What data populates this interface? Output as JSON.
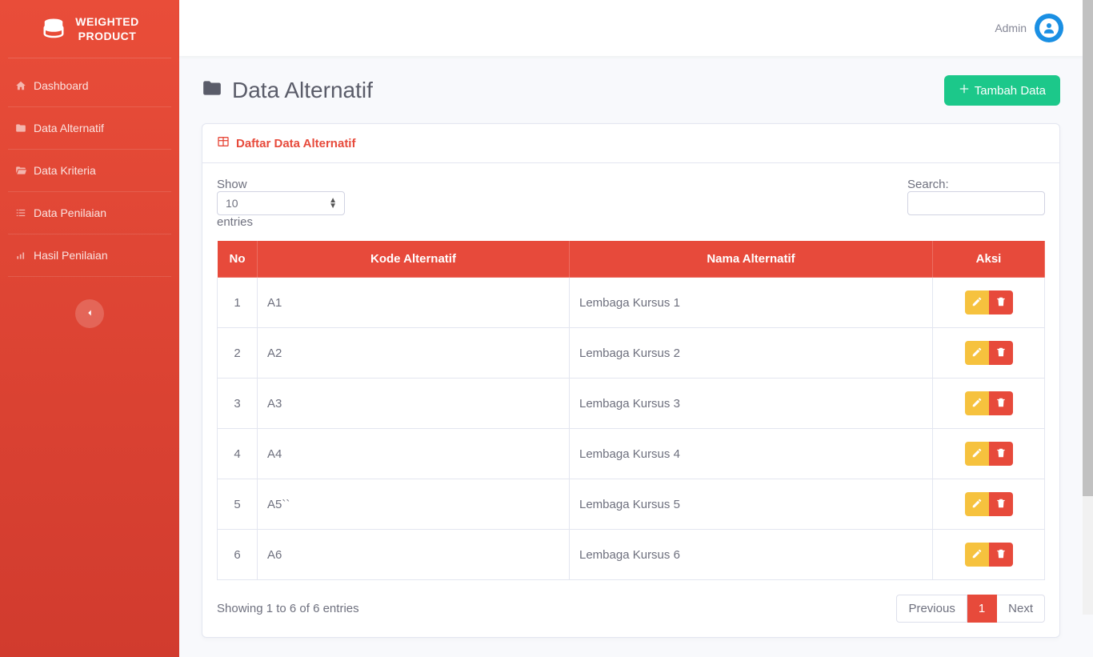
{
  "brand": {
    "line1": "WEIGHTED",
    "line2": "PRODUCT"
  },
  "sidebar": {
    "items": [
      {
        "label": "Dashboard",
        "icon": "dashboard-icon"
      },
      {
        "label": "Data Alternatif",
        "icon": "folder-icon"
      },
      {
        "label": "Data Kriteria",
        "icon": "folder-open-icon"
      },
      {
        "label": "Data Penilaian",
        "icon": "list-icon"
      },
      {
        "label": "Hasil Penilaian",
        "icon": "chart-icon"
      }
    ]
  },
  "topbar": {
    "username": "Admin"
  },
  "page": {
    "title": "Data Alternatif",
    "add_button": "Tambah Data",
    "card_title": "Daftar Data Alternatif"
  },
  "datatable": {
    "show_label": "Show",
    "entries_label": "entries",
    "length_value": "10",
    "search_label": "Search:",
    "search_value": "",
    "columns": {
      "no": "No",
      "kode": "Kode Alternatif",
      "nama": "Nama Alternatif",
      "aksi": "Aksi"
    },
    "rows": [
      {
        "no": "1",
        "kode": "A1",
        "nama": "Lembaga Kursus 1"
      },
      {
        "no": "2",
        "kode": "A2",
        "nama": "Lembaga Kursus 2"
      },
      {
        "no": "3",
        "kode": "A3",
        "nama": "Lembaga Kursus 3"
      },
      {
        "no": "4",
        "kode": "A4",
        "nama": "Lembaga Kursus 4"
      },
      {
        "no": "5",
        "kode": "A5``",
        "nama": "Lembaga Kursus 5"
      },
      {
        "no": "6",
        "kode": "A6",
        "nama": "Lembaga Kursus 6"
      }
    ],
    "info": "Showing 1 to 6 of 6 entries",
    "pagination": {
      "prev": "Previous",
      "pages": [
        "1"
      ],
      "next": "Next",
      "active": "1"
    }
  }
}
